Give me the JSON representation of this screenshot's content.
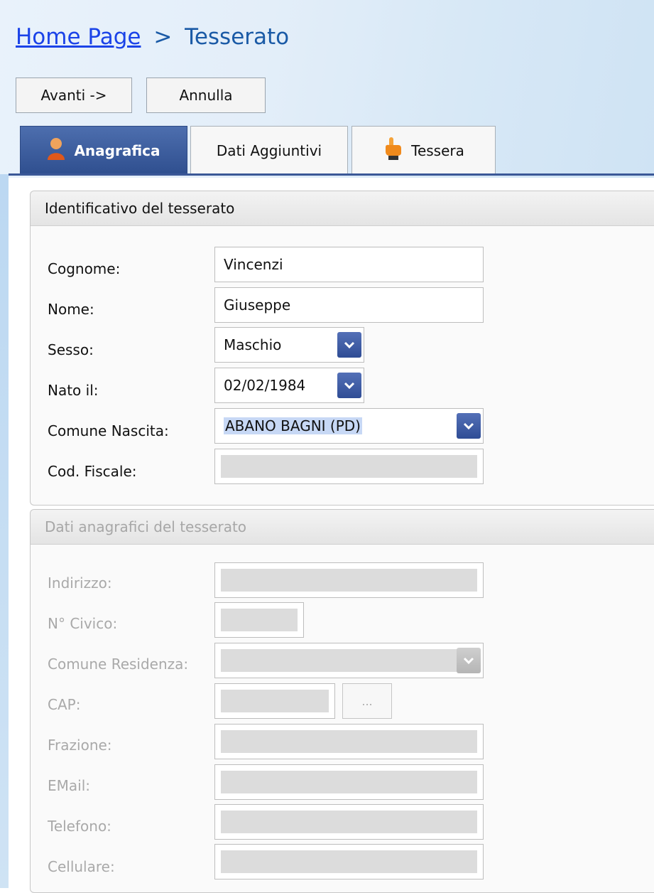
{
  "breadcrumb": {
    "home": "Home Page",
    "separator": ">",
    "current": "Tesserato"
  },
  "toolbar": {
    "next_label": "Avanti ->",
    "cancel_label": "Annulla"
  },
  "tabs": [
    {
      "label": "Anagrafica",
      "icon": "user-icon",
      "active": true
    },
    {
      "label": "Dati Aggiuntivi",
      "active": false
    },
    {
      "label": "Tessera",
      "icon": "hand-pointer-icon",
      "active": false
    }
  ],
  "identificativo": {
    "title": "Identificativo del tesserato",
    "cognome": {
      "label": "Cognome:",
      "value": "Vincenzi"
    },
    "nome": {
      "label": "Nome:",
      "value": "Giuseppe"
    },
    "sesso": {
      "label": "Sesso:",
      "value": "Maschio"
    },
    "nato_il": {
      "label": "Nato il:",
      "value": "02/02/1984"
    },
    "comune_nascita": {
      "label": "Comune Nascita:",
      "value": "ABANO BAGNI (PD)"
    },
    "cod_fiscale": {
      "label": "Cod. Fiscale:",
      "value": ""
    }
  },
  "anagrafici": {
    "title": "Dati anagrafici del tesserato",
    "indirizzo": {
      "label": "Indirizzo:",
      "value": ""
    },
    "civico": {
      "label": "N° Civico:",
      "value": ""
    },
    "comune_residenza": {
      "label": "Comune Residenza:",
      "value": ""
    },
    "cap": {
      "label": "CAP:",
      "value": "",
      "button": "..."
    },
    "frazione": {
      "label": "Frazione:",
      "value": ""
    },
    "email": {
      "label": "EMail:",
      "value": ""
    },
    "telefono": {
      "label": "Telefono:",
      "value": ""
    },
    "cellulare": {
      "label": "Cellulare:",
      "value": ""
    }
  },
  "colors": {
    "accent": "#2f4f8f",
    "link": "#1b43e8",
    "disabled_text": "#a9a9a9"
  }
}
